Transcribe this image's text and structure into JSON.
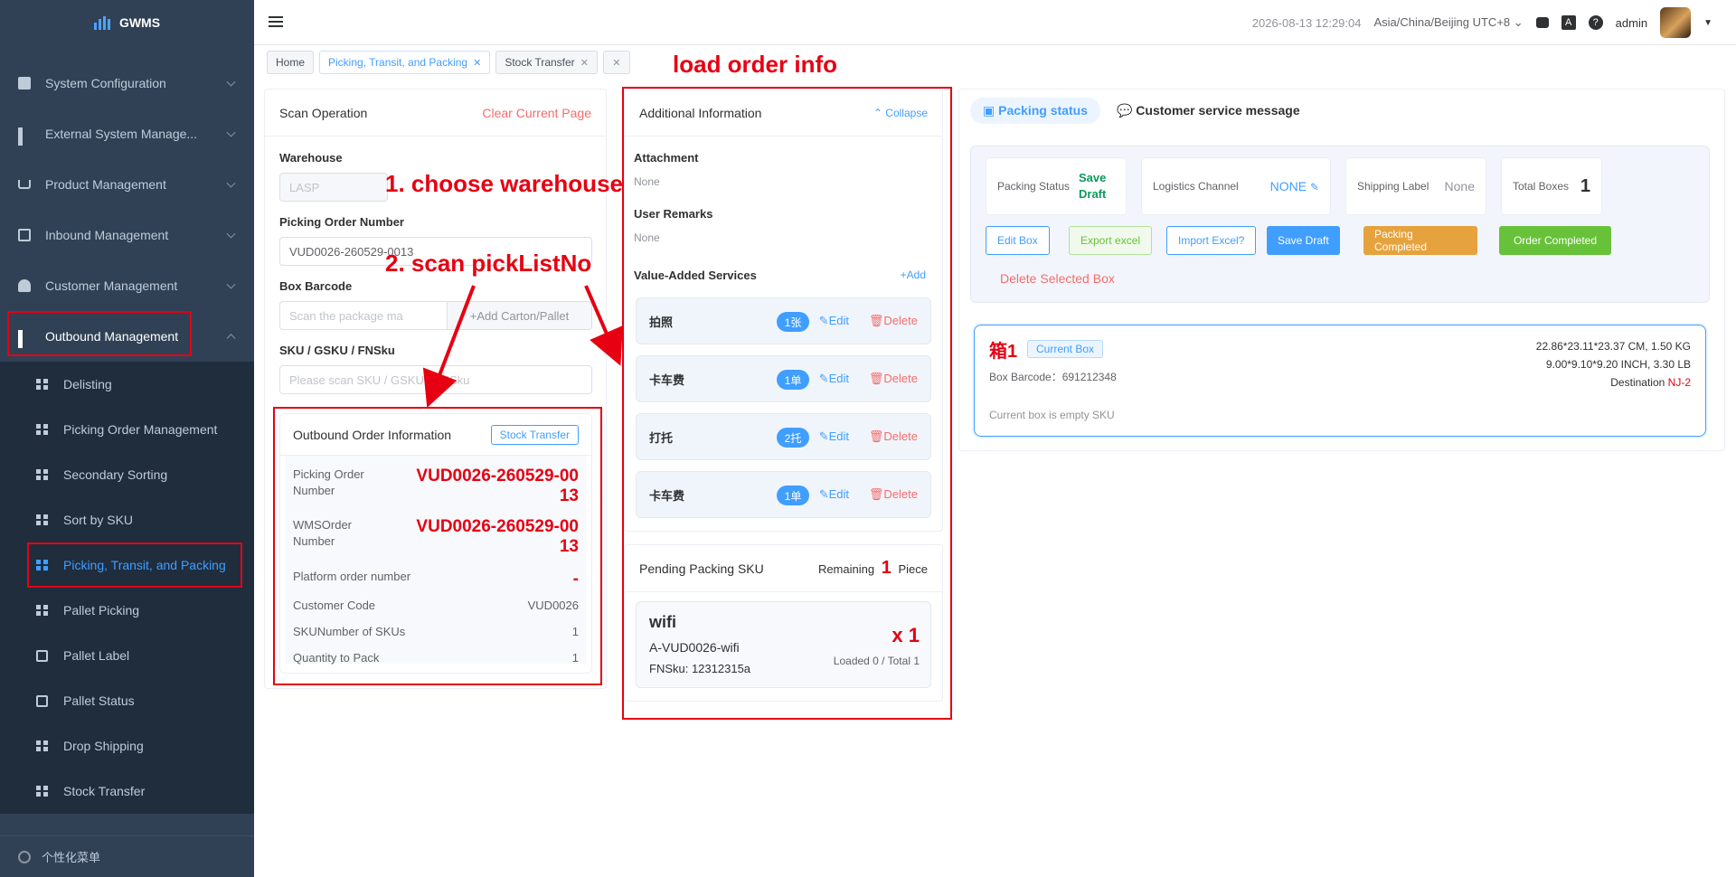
{
  "app": {
    "name": "GWMS"
  },
  "sidebar": {
    "items": [
      {
        "label": "System Configuration"
      },
      {
        "label": "External System Manage..."
      },
      {
        "label": "Product Management"
      },
      {
        "label": "Inbound Management"
      },
      {
        "label": "Customer Management"
      },
      {
        "label": "Outbound Management"
      }
    ],
    "sub_items": [
      {
        "label": "Delisting"
      },
      {
        "label": "Picking Order Management"
      },
      {
        "label": "Secondary Sorting"
      },
      {
        "label": "Sort by SKU"
      },
      {
        "label": "Picking, Transit, and Packing"
      },
      {
        "label": "Pallet Picking"
      },
      {
        "label": "Pallet Label"
      },
      {
        "label": "Pallet Status"
      },
      {
        "label": "Drop Shipping"
      },
      {
        "label": "Stock Transfer"
      }
    ],
    "footer_label": "个性化菜单"
  },
  "header": {
    "datetime": "2026-08-13 12:29:04",
    "timezone": "Asia/China/Beijing UTC+8",
    "user": "admin",
    "help_glyph": "?"
  },
  "tabs": [
    {
      "label": "Home"
    },
    {
      "label": "Picking, Transit, and Packing"
    },
    {
      "label": "Stock Transfer"
    }
  ],
  "scan": {
    "title": "Scan Operation",
    "clear_label": "Clear Current Page",
    "warehouse_label": "Warehouse",
    "warehouse_value": "LASP",
    "picking_label": "Picking Order Number",
    "picking_value": "VUD0026-260529-0013",
    "box_label": "Box Barcode",
    "box_placeholder": "Scan the package ma",
    "add_carton_label": "Add Carton/Pallet",
    "sku_label": "SKU / GSKU / FNSku",
    "sku_placeholder": "Please scan SKU / GSKU / FNSku"
  },
  "outbound": {
    "title": "Outbound Order Information",
    "stock_transfer_label": "Stock Transfer",
    "rows": {
      "picking_label": "Picking Order Number",
      "picking_value": "VUD0026-260529-0013",
      "wms_label": "WMSOrder Number",
      "wms_value": "VUD0026-260529-0013",
      "platform_label": "Platform order number",
      "platform_value": "-",
      "customer_label": "Customer Code",
      "customer_value": "VUD0026",
      "skunum_label": "SKUNumber of SKUs",
      "skunum_value": "1",
      "qty_label": "Quantity to Pack",
      "qty_value": "1"
    }
  },
  "additional": {
    "title": "Additional Information",
    "collapse_label": "Collapse",
    "attachment_label": "Attachment",
    "attachment_value": "None",
    "remarks_label": "User Remarks",
    "remarks_value": "None",
    "vas_label": "Value-Added Services",
    "add_label": "+Add",
    "edit_label": "Edit",
    "delete_label": "Delete",
    "services": [
      {
        "name": "拍照",
        "badge": "1张"
      },
      {
        "name": "卡车费",
        "badge": "1单"
      },
      {
        "name": "打托",
        "badge": "2托"
      },
      {
        "name": "卡车费",
        "badge": "1单"
      }
    ]
  },
  "pending": {
    "title": "Pending Packing SKU",
    "remaining_label": "Remaining",
    "remaining_value": "1",
    "piece_label": "Piece",
    "sku_name": "wifi",
    "sku_code": "A-VUD0026-wifi",
    "fnsku": "FNSku: 12312315a",
    "qty": "x 1",
    "loaded": "Loaded 0 / Total 1"
  },
  "packing": {
    "tab_status": "Packing status",
    "tab_message": "Customer service message",
    "status_label": "Packing Status",
    "status_value": "Save Draft",
    "logistics_label": "Logistics Channel",
    "logistics_value": "NONE",
    "shipping_label": "Shipping Label",
    "shipping_value": "None",
    "boxes_label": "Total Boxes",
    "boxes_value": "1",
    "buttons": {
      "edit_box": "Edit Box",
      "export": "Export excel",
      "import": "Import Excel?",
      "save_draft": "Save Draft",
      "packing_completed": "Packing Completed",
      "order_completed": "Order Completed",
      "delete_box": "Delete Selected Box"
    },
    "box": {
      "name": "箱1",
      "current_label": "Current Box",
      "barcode": "Box Barcode：691212348",
      "dims_cm": "22.86*23.11*23.37 CM, 1.50 KG",
      "dims_inch": "9.00*9.10*9.20 INCH, 3.30 LB",
      "destination_label": "Destination",
      "destination_value": "NJ-2",
      "empty_text": "Current box is empty SKU"
    }
  },
  "annotations": {
    "load_order": "load order info",
    "choose_warehouse": "1. choose warehouse",
    "scan_picklist": "2. scan pickListNo"
  }
}
